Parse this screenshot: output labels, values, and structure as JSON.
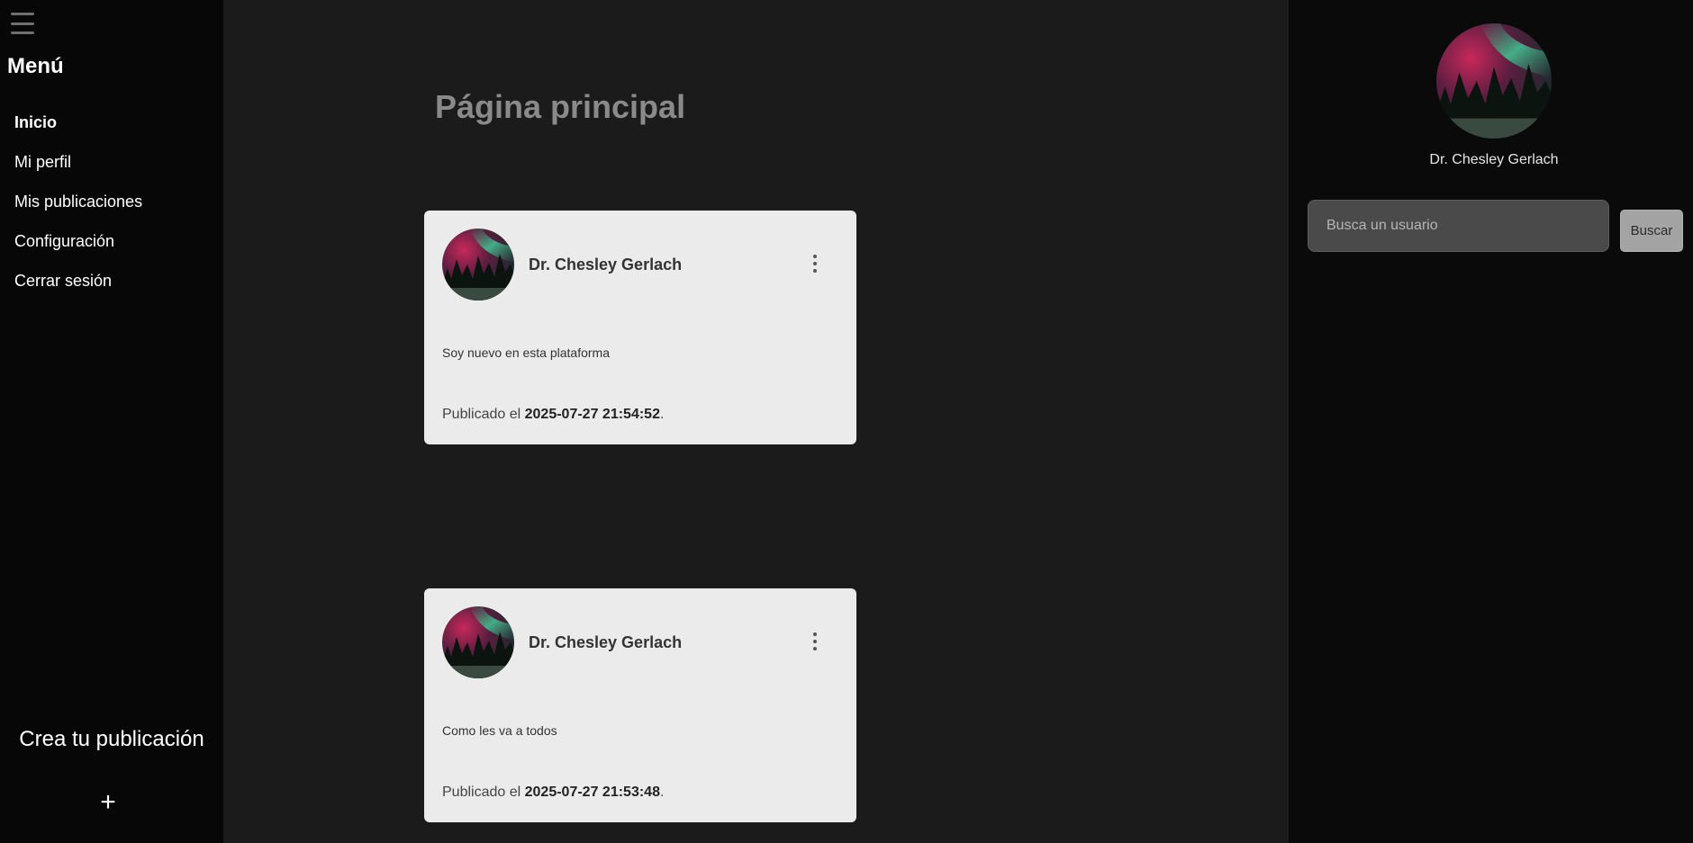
{
  "sidebar": {
    "menu_title": "Menú",
    "items": [
      {
        "label": "Inicio"
      },
      {
        "label": "Mi perfil"
      },
      {
        "label": "Mis publicaciones"
      },
      {
        "label": "Configuración"
      },
      {
        "label": "Cerrar sesión"
      }
    ],
    "create_label": "Crea tu publicación",
    "create_icon": "+"
  },
  "main": {
    "title": "Página principal",
    "posts": [
      {
        "author": "Dr. Chesley Gerlach",
        "content": "Soy nuevo en esta plataforma",
        "date_prefix": "Publicado el ",
        "date": "2025-07-27 21:54:52",
        "date_suffix": "."
      },
      {
        "author": "Dr. Chesley Gerlach",
        "content": "Como les va a todos",
        "date_prefix": "Publicado el ",
        "date": "2025-07-27 21:53:48",
        "date_suffix": "."
      }
    ]
  },
  "right": {
    "user_name": "Dr. Chesley Gerlach",
    "search_placeholder": "Busca un usuario",
    "search_button": "Buscar"
  },
  "colors": {
    "sidebar_bg": "#070707",
    "main_bg": "#1b1b1b",
    "right_bg": "#0a0a0a",
    "card_bg": "#ebebeb"
  }
}
